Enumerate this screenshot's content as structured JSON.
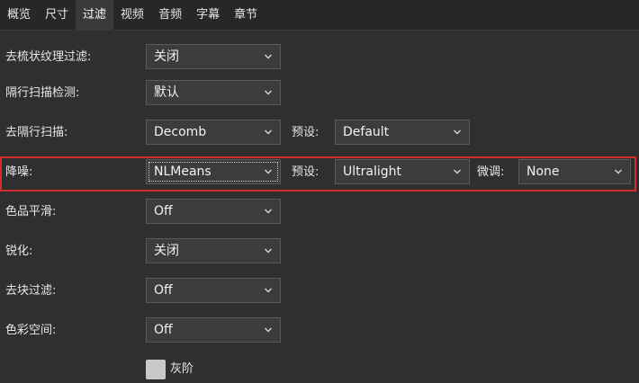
{
  "tabs": [
    {
      "label": "概览"
    },
    {
      "label": "尺寸"
    },
    {
      "label": "过滤",
      "active": true
    },
    {
      "label": "视频"
    },
    {
      "label": "音频"
    },
    {
      "label": "字幕"
    },
    {
      "label": "章节"
    }
  ],
  "filters": {
    "detelecine": {
      "label": "去梳状纹理过滤:",
      "value": "关闭"
    },
    "interlace_detection": {
      "label": "隔行扫描检测:",
      "value": "默认"
    },
    "deinterlace": {
      "label": "去隔行扫描:",
      "value": "Decomb",
      "preset_label": "预设:",
      "preset_value": "Default"
    },
    "denoise": {
      "label": "降噪:",
      "value": "NLMeans",
      "preset_label": "预设:",
      "preset_value": "Ultralight",
      "tune_label": "微调:",
      "tune_value": "None"
    },
    "chroma_smooth": {
      "label": "色品平滑:",
      "value": "Off"
    },
    "sharpen": {
      "label": "锐化:",
      "value": "关闭"
    },
    "deblock": {
      "label": "去块过滤:",
      "value": "Off"
    },
    "colorspace": {
      "label": "色彩空间:",
      "value": "Off"
    },
    "grayscale": {
      "label": "灰阶",
      "checked": false
    }
  },
  "colors": {
    "background": "#2f2f2f",
    "highlight_border": "#d32f2f"
  },
  "icons": {
    "dropdown": "chevron-down-icon"
  }
}
